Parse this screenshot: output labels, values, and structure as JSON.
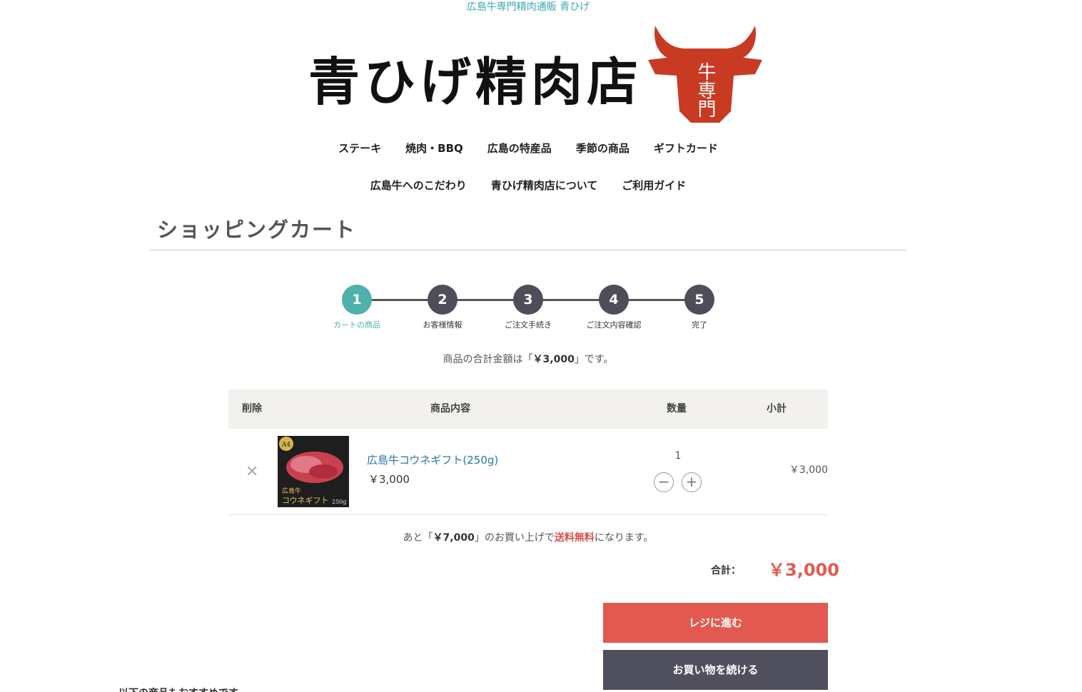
{
  "header": {
    "tagline": "広島牛専門精肉通販 青ひげ",
    "logo_text": "青ひげ精肉店",
    "logo_mark_text": "牛専門"
  },
  "nav": {
    "row1": [
      "ステーキ",
      "焼肉・BBQ",
      "広島の特産品",
      "季節の商品",
      "ギフトカード"
    ],
    "row2": [
      "広島牛へのこだわり",
      "青ひげ精肉店について",
      "ご利用ガイド"
    ]
  },
  "page": {
    "title": "ショッピングカート"
  },
  "steps": [
    {
      "num": "1",
      "label": "カートの商品"
    },
    {
      "num": "2",
      "label": "お客様情報"
    },
    {
      "num": "3",
      "label": "ご注文手続き"
    },
    {
      "num": "4",
      "label": "ご注文内容確認"
    },
    {
      "num": "5",
      "label": "完了"
    }
  ],
  "summary": {
    "prefix": "商品の合計金額は「",
    "amount": "￥3,000",
    "suffix": "」です。"
  },
  "table": {
    "headers": {
      "delete": "削除",
      "product": "商品内容",
      "qty": "数量",
      "subtotal": "小計"
    },
    "rows": [
      {
        "name": "広島牛コウネギフト(250g)",
        "price": "￥3,000",
        "qty": "1",
        "subtotal": "￥3,000",
        "thumb_badge": "A4",
        "thumb_caption_top": "広島牛",
        "thumb_caption": "コウネギフト",
        "thumb_weight": "250g"
      }
    ]
  },
  "free_shipping": {
    "prefix": "あと「",
    "amount": "￥7,000",
    "middle": "」のお買い上げで",
    "highlight": "送料無料",
    "suffix": "になります。"
  },
  "total": {
    "label": "合計：",
    "value": "￥3,000"
  },
  "buttons": {
    "checkout": "レジに進む",
    "continue": "お買い物を続ける"
  },
  "footer_cut": "以下の商品もおすすめです",
  "colors": {
    "accent": "#4fb0ac",
    "checkout": "#e25a4f",
    "dark": "#4f4f5d",
    "link": "#2a74a8"
  }
}
